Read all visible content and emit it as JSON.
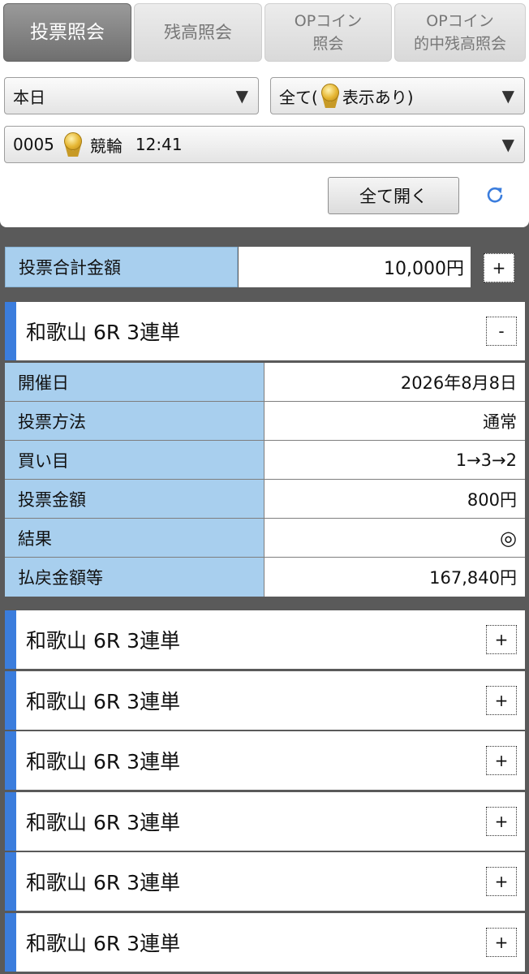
{
  "tabs": [
    {
      "label": "投票照会"
    },
    {
      "label": "残高照会"
    },
    {
      "line1": "OPコイン",
      "line2": "照会"
    },
    {
      "line1": "OPコイン",
      "line2": "的中残高照会"
    }
  ],
  "filters": {
    "date": "本日",
    "display_prefix": "全て(",
    "display_suffix": "表示あり)",
    "race_number": "0005",
    "race_type": "競輪",
    "race_time": "12:41"
  },
  "buttons": {
    "open_all": "全て開く",
    "plus": "+",
    "minus": "-"
  },
  "total": {
    "label": "投票合計金額",
    "value": "10,000円"
  },
  "expanded_bet": {
    "title": "和歌山 6R 3連単",
    "rows": [
      {
        "label": "開催日",
        "value": "2026年8月8日"
      },
      {
        "label": "投票方法",
        "value": "通常"
      },
      {
        "label": "買い目",
        "value": "1→3→2"
      },
      {
        "label": "投票金額",
        "value": "800円"
      },
      {
        "label": "結果",
        "value": "◎"
      },
      {
        "label": "払戻金額等",
        "value": "167,840円"
      }
    ]
  },
  "collapsed_bets": [
    {
      "title": "和歌山 6R 3連単"
    },
    {
      "title": "和歌山 6R 3連単"
    },
    {
      "title": "和歌山 6R 3連単"
    },
    {
      "title": "和歌山 6R 3連単"
    },
    {
      "title": "和歌山 6R 3連単"
    },
    {
      "title": "和歌山 6R 3連単"
    }
  ],
  "colors": {
    "accent": "#3b7ddd",
    "label_bg": "#a8cfee",
    "background": "#5a5a5a"
  }
}
